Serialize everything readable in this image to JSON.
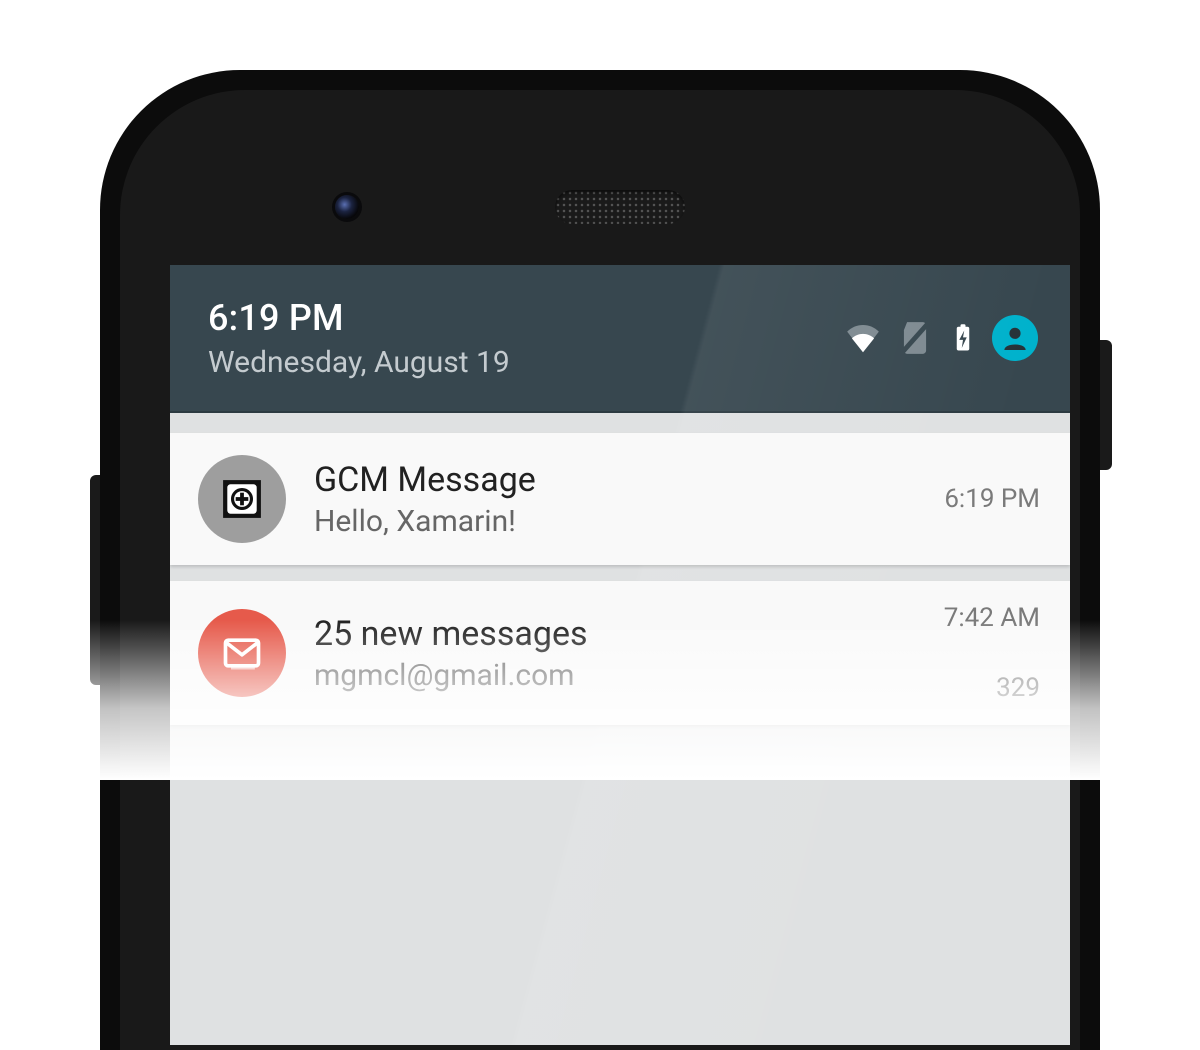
{
  "status": {
    "time": "6:19 PM",
    "date": "Wednesday, August 19"
  },
  "notifications": [
    {
      "title": "GCM Message",
      "text": "Hello, Xamarin!",
      "timestamp": "6:19 PM",
      "sub": ""
    },
    {
      "title": "25 new messages",
      "text": "mgmcl@gmail.com",
      "timestamp": "7:42 AM",
      "sub": "329"
    }
  ]
}
